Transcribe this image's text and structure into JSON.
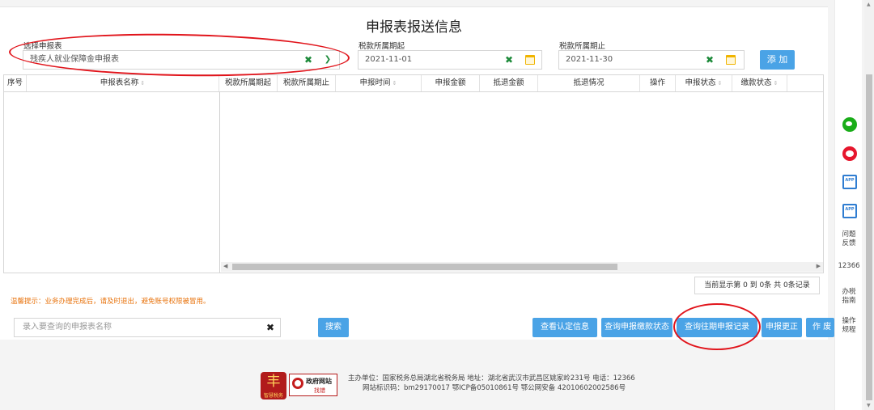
{
  "page": {
    "title": "申报表报送信息"
  },
  "filters": {
    "form_label": "选择申报表",
    "form_value": "残疾人就业保障金申报表",
    "start_label": "税款所属期起",
    "start_value": "2021-11-01",
    "end_label": "税款所属期止",
    "end_value": "2021-11-30",
    "add_label": "添 加"
  },
  "table": {
    "columns": [
      "序号",
      "申报表名称",
      "税款所属期起",
      "税款所属期止",
      "申报时间",
      "申报金额",
      "抵退金额",
      "抵退情况",
      "操作",
      "申报状态",
      "缴款状态"
    ],
    "rows": [],
    "pager_text": "当前显示第  0 到  0条  共  0条记录"
  },
  "tip": "温馨提示：业务办理完成后，请及时退出，避免账号权限被冒用。",
  "search": {
    "placeholder": "录入要查询的申报表名称",
    "button": "搜索"
  },
  "actions": [
    "查看认定信息",
    "查询申报缴款状态",
    "查询往期申报记录",
    "申报更正",
    "作 废"
  ],
  "footer": {
    "line1": "主办单位：国家税务总局湖北省税务局   地址：湖北省武汉市武昌区姚家岭231号  电话：12366",
    "line2": "网站标识码：bm29170017   鄂ICP备05010861号  鄂公网安备 42010602002586号",
    "gov_logo_line1": "政府网站",
    "gov_logo_line2": "找错",
    "badge_logo_text": "智慧税务"
  },
  "sidebar": {
    "wechat_icon": "wechat-icon",
    "weibo_icon": "weibo-icon",
    "app_label_1": "APP",
    "app_label_2": "APP",
    "feedback": "问题反馈",
    "hotline": "12366",
    "guide": "办税指南",
    "procedure": "操作规程"
  },
  "colors": {
    "accent": "#4aa3e6",
    "highlight": "#e1141b",
    "tip": "#e8730d",
    "check": "#1d8a3a"
  }
}
